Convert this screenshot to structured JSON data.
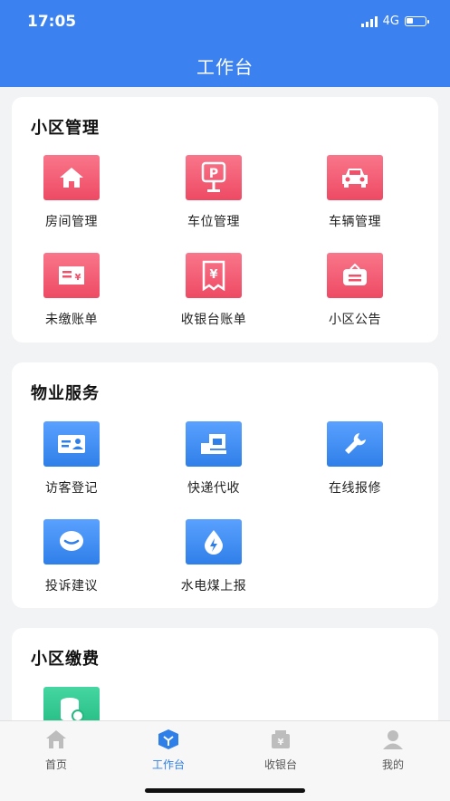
{
  "status": {
    "time": "17:05",
    "network": "4G"
  },
  "header": {
    "title": "工作台"
  },
  "sections": [
    {
      "title": "小区管理",
      "items": [
        {
          "label": "房间管理",
          "icon": "house-icon"
        },
        {
          "label": "车位管理",
          "icon": "parking-icon"
        },
        {
          "label": "车辆管理",
          "icon": "car-icon"
        },
        {
          "label": "未缴账单",
          "icon": "unpaid-bill-icon"
        },
        {
          "label": "收银台账单",
          "icon": "cashier-bill-icon"
        },
        {
          "label": "小区公告",
          "icon": "announcement-icon"
        }
      ]
    },
    {
      "title": "物业服务",
      "items": [
        {
          "label": "访客登记",
          "icon": "visitor-card-icon"
        },
        {
          "label": "快递代收",
          "icon": "package-icon"
        },
        {
          "label": "在线报修",
          "icon": "wrench-icon"
        },
        {
          "label": "投诉建议",
          "icon": "chat-bubble-icon"
        },
        {
          "label": "水电煤上报",
          "icon": "utility-drop-icon"
        }
      ]
    },
    {
      "title": "小区缴费",
      "items": [
        {
          "label": "",
          "icon": "coins-icon"
        }
      ]
    }
  ],
  "tabbar": {
    "items": [
      {
        "label": "首页",
        "icon": "home-tab-icon",
        "active": false
      },
      {
        "label": "工作台",
        "icon": "workbench-tab-icon",
        "active": true
      },
      {
        "label": "收银台",
        "icon": "cashier-tab-icon",
        "active": false
      },
      {
        "label": "我的",
        "icon": "profile-tab-icon",
        "active": false
      }
    ]
  },
  "colors": {
    "primary": "#3b82f0",
    "red_icon": "#f0506a",
    "blue_icon": "#2f7fe9",
    "green_icon": "#2cc48b"
  }
}
